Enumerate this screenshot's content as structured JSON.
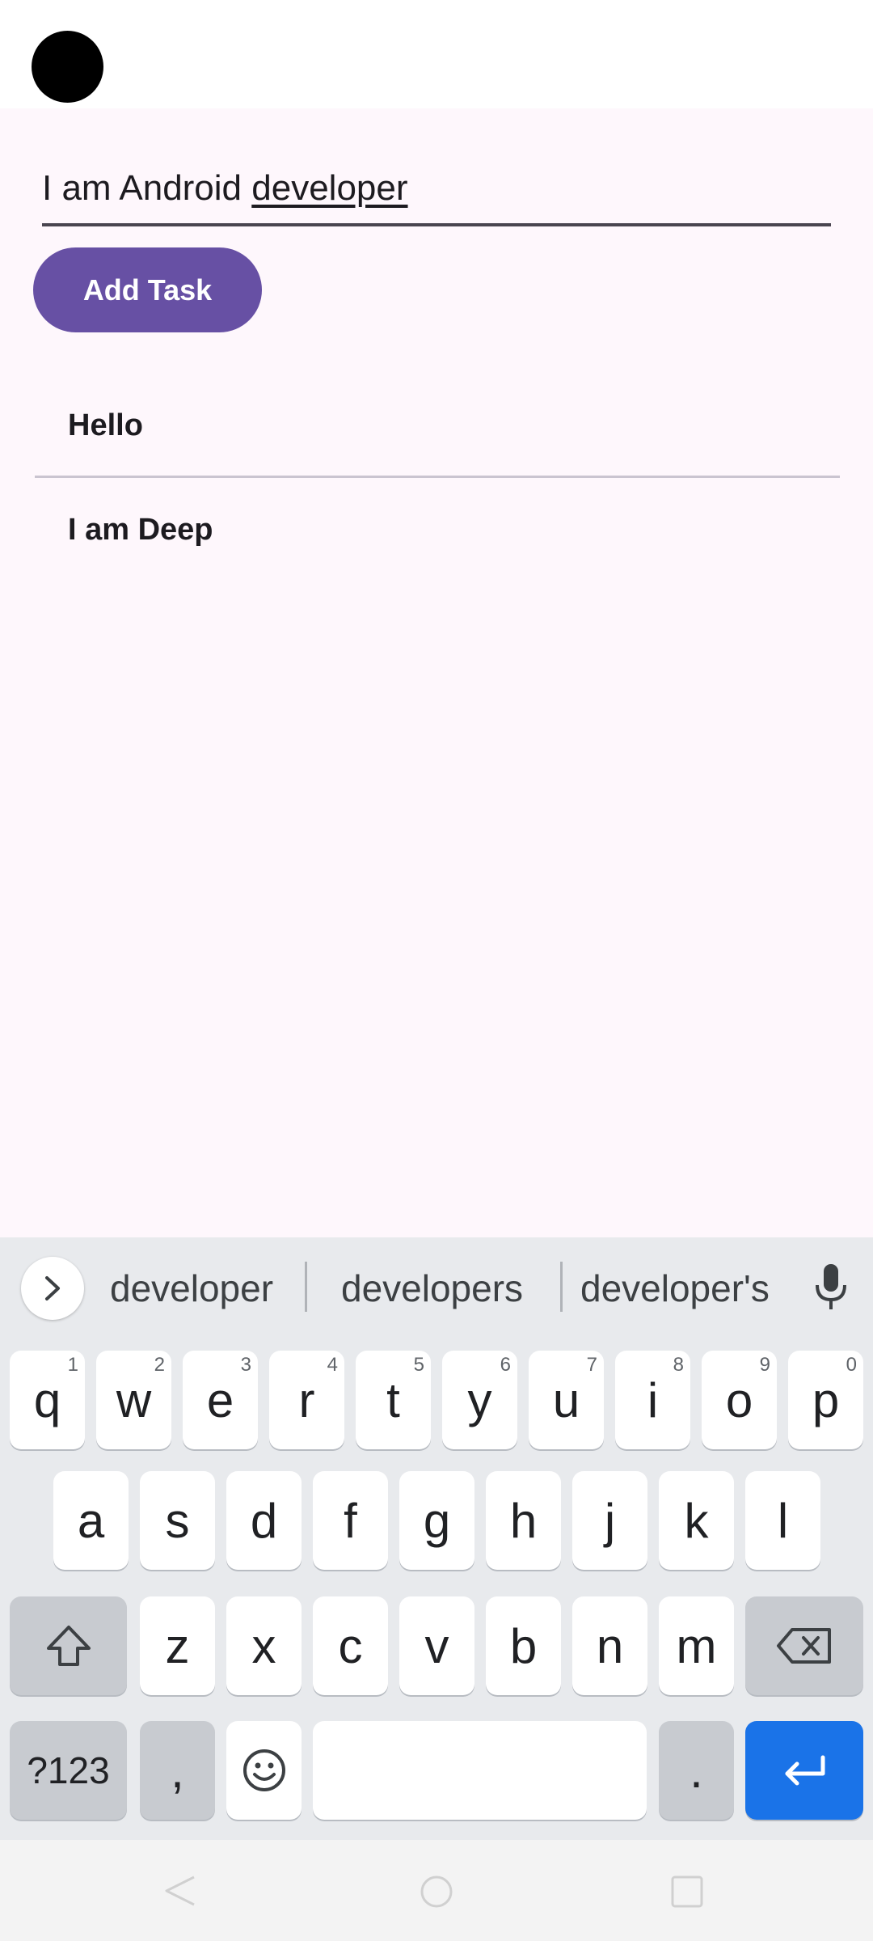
{
  "text_field": {
    "value_prefix": "I am Android ",
    "value_composing": "developer"
  },
  "add_task_button": {
    "label": "Add Task"
  },
  "tasks": [
    {
      "label": "Hello"
    },
    {
      "label": "I am Deep"
    }
  ],
  "keyboard": {
    "suggestions": [
      "developer",
      "developers",
      "developer's"
    ],
    "row1": [
      {
        "key": "q",
        "hint": "1"
      },
      {
        "key": "w",
        "hint": "2"
      },
      {
        "key": "e",
        "hint": "3"
      },
      {
        "key": "r",
        "hint": "4"
      },
      {
        "key": "t",
        "hint": "5"
      },
      {
        "key": "y",
        "hint": "6"
      },
      {
        "key": "u",
        "hint": "7"
      },
      {
        "key": "i",
        "hint": "8"
      },
      {
        "key": "o",
        "hint": "9"
      },
      {
        "key": "p",
        "hint": "0"
      }
    ],
    "row2": [
      "a",
      "s",
      "d",
      "f",
      "g",
      "h",
      "j",
      "k",
      "l"
    ],
    "row3": [
      "z",
      "x",
      "c",
      "v",
      "b",
      "n",
      "m"
    ],
    "symbols_key": "?123",
    "comma_key": ",",
    "period_key": "."
  },
  "colors": {
    "primary": "#6750a4",
    "surface": "#fef7fc",
    "enter_key": "#1a73e8"
  }
}
